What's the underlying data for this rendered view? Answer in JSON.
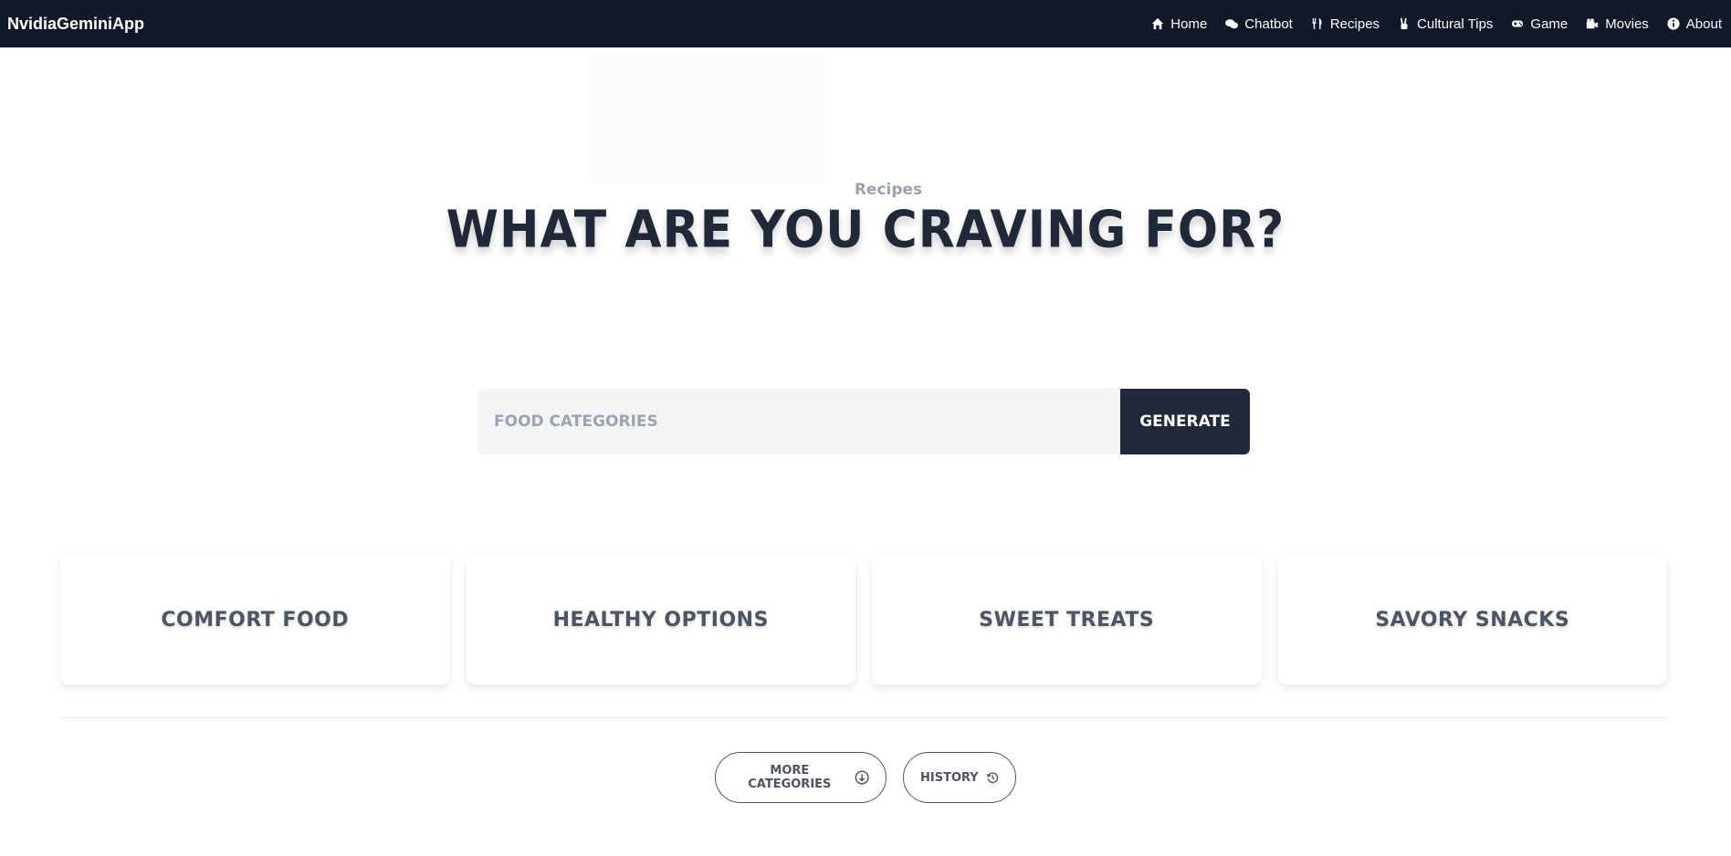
{
  "nav": {
    "brand": "NvidiaGeminiApp",
    "links": [
      {
        "label": "Home",
        "icon": "home-icon"
      },
      {
        "label": "Chatbot",
        "icon": "chat-bubbles-icon"
      },
      {
        "label": "Recipes",
        "icon": "utensils-icon"
      },
      {
        "label": "Cultural Tips",
        "icon": "peace-hand-icon"
      },
      {
        "label": "Game",
        "icon": "gamepad-icon"
      },
      {
        "label": "Movies",
        "icon": "video-camera-icon"
      },
      {
        "label": "About",
        "icon": "info-circle-icon"
      }
    ]
  },
  "hero": {
    "eyebrow": "Recipes",
    "headline": "What are you craving for?"
  },
  "search": {
    "placeholder": "Food Categories",
    "value": "",
    "button_label": "Generate"
  },
  "categories": [
    {
      "label": "Comfort Food"
    },
    {
      "label": "Healthy Options"
    },
    {
      "label": "Sweet Treats"
    },
    {
      "label": "Savory Snacks"
    }
  ],
  "actions": {
    "more_label": "More Categories",
    "more_icon": "arrow-down-circle-icon",
    "history_label": "History",
    "history_icon": "history-icon"
  },
  "colors": {
    "navbar_bg": "#111827",
    "primary_dark": "#1f2937",
    "input_bg": "#f3f4f6",
    "muted_text": "#9ca3af"
  }
}
